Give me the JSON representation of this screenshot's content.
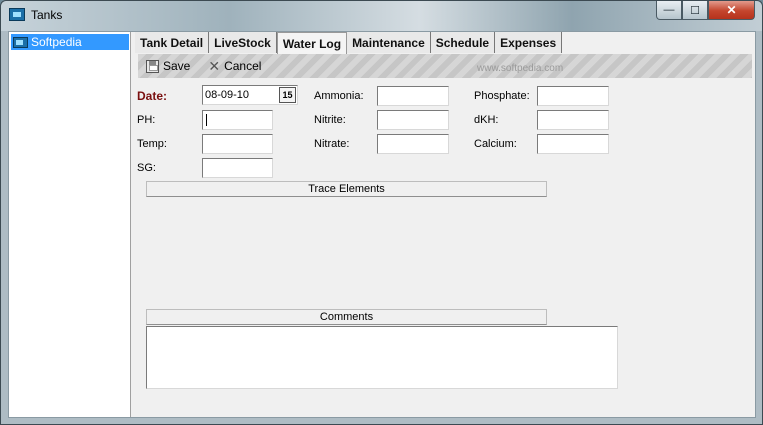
{
  "window": {
    "title": "Tanks",
    "controls": {
      "minimize": "—",
      "maximize": "☐",
      "close": "✕"
    }
  },
  "tree": {
    "items": [
      {
        "label": "Softpedia"
      }
    ]
  },
  "tabs": [
    {
      "label": "Tank Detail"
    },
    {
      "label": "LiveStock"
    },
    {
      "label": "Water Log",
      "active": true
    },
    {
      "label": "Maintenance"
    },
    {
      "label": "Schedule"
    },
    {
      "label": "Expenses"
    }
  ],
  "toolbar": {
    "save_label": "Save",
    "cancel_label": "Cancel"
  },
  "watermark": "www.softpedia.com",
  "form": {
    "date_label": "Date:",
    "date_value": "08-09-10",
    "date_button": "15",
    "ph_label": "PH:",
    "temp_label": "Temp:",
    "sg_label": "SG:",
    "ammonia_label": "Ammonia:",
    "nitrite_label": "Nitrite:",
    "nitrate_label": "Nitrate:",
    "phosphate_label": "Phosphate:",
    "dkh_label": "dKH:",
    "calcium_label": "Calcium:"
  },
  "sections": {
    "trace_elements": "Trace Elements",
    "comments": "Comments"
  }
}
